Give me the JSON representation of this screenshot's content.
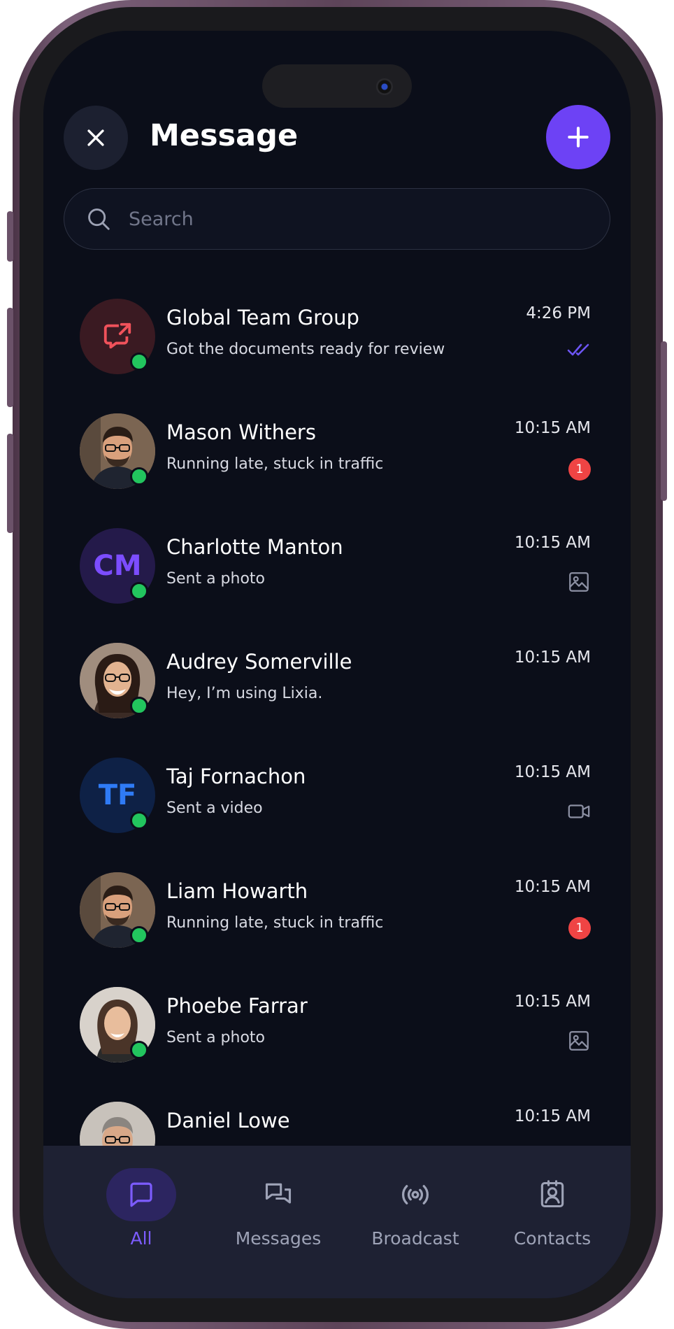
{
  "header": {
    "title": "Message"
  },
  "search": {
    "placeholder": "Search"
  },
  "chats": [
    {
      "name": "Global Team Group",
      "preview": "Got the documents ready for review",
      "time": "4:26 PM",
      "status": "read",
      "avatar": "group-icon"
    },
    {
      "name": "Mason Withers",
      "preview": "Running late, stuck in traffic",
      "time": "10:15 AM",
      "unread": "1",
      "avatar": "photo"
    },
    {
      "name": "Charlotte Manton",
      "preview": "Sent a photo",
      "time": "10:15 AM",
      "attachment": "image-icon",
      "initials": "CM"
    },
    {
      "name": "Audrey Somerville",
      "preview": "Hey, I’m using Lixia.",
      "time": "10:15 AM",
      "avatar": "photo"
    },
    {
      "name": "Taj Fornachon",
      "preview": "Sent a video",
      "time": "10:15 AM",
      "attachment": "video-icon",
      "initials": "TF"
    },
    {
      "name": "Liam Howarth",
      "preview": "Running late, stuck in traffic",
      "time": "10:15 AM",
      "unread": "1",
      "avatar": "photo"
    },
    {
      "name": "Phoebe Farrar",
      "preview": "Sent a photo",
      "time": "10:15 AM",
      "attachment": "image-icon",
      "avatar": "photo"
    },
    {
      "name": "Daniel Lowe",
      "preview": "",
      "time": "10:15 AM",
      "avatar": "photo"
    }
  ],
  "tabs": [
    {
      "label": "All",
      "icon": "chat-icon",
      "active": true
    },
    {
      "label": "Messages",
      "icon": "messages-icon"
    },
    {
      "label": "Broadcast",
      "icon": "broadcast-icon"
    },
    {
      "label": "Contacts",
      "icon": "contacts-icon"
    }
  ],
  "colors": {
    "accent": "#6d42f5",
    "online": "#22c55e",
    "badge": "#ef4444",
    "background": "#0b0e19"
  }
}
